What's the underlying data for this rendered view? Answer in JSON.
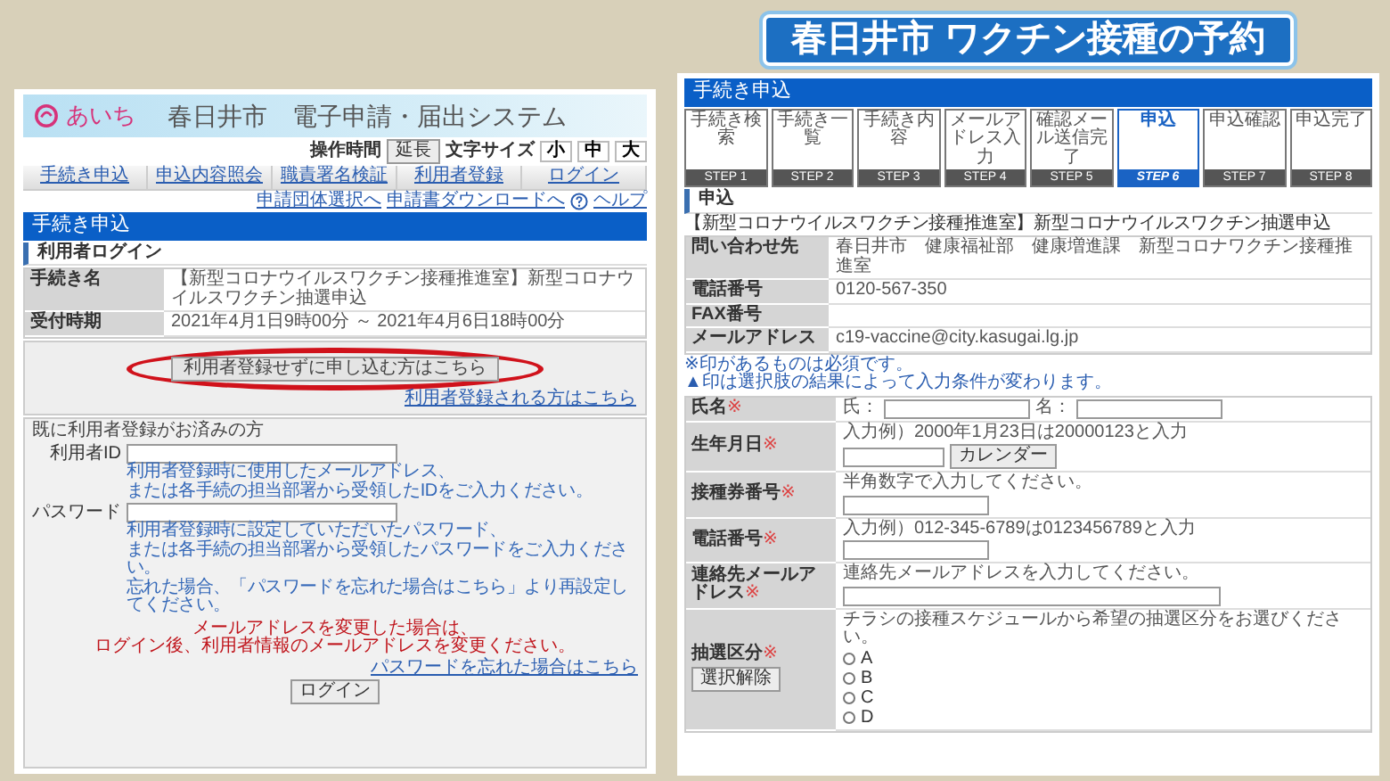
{
  "headline": "春日井市 ワクチン接種の予約",
  "left": {
    "logo": "あいち",
    "system_title": "春日井市　電子申請・届出システム",
    "toolbar": {
      "time_label": "操作時間",
      "extend_button": "延長",
      "font_size_label": "文字サイズ",
      "font_sizes": [
        "小",
        "中",
        "大"
      ]
    },
    "nav": [
      "手続き申込",
      "申込内容照会",
      "職責署名検証",
      "利用者登録",
      "ログイン"
    ],
    "links": [
      "申請団体選択へ",
      "申請書ダウンロードへ",
      "ヘルプ"
    ],
    "section_title": "手続き申込",
    "subsection": "利用者ログイン",
    "info_rows": [
      {
        "label": "手続き名",
        "value": "【新型コロナウイルスワクチン接種推進室】新型コロナウイルスワクチン抽選申込"
      },
      {
        "label": "受付時期",
        "value": "2021年4月1日9時00分 ～ 2021年4月6日18時00分"
      }
    ],
    "guest_button": {
      "label": "利用者登録せずに申し込む方はこちら",
      "circled": true
    },
    "register_link": "利用者登録される方はこちら",
    "login": {
      "title": "既に利用者登録がお済みの方",
      "fields": [
        {
          "label": "利用者ID",
          "hint": [
            "利用者登録時に使用したメールアドレス、",
            "または各手続の担当部署から受領したIDをご入力ください。"
          ]
        },
        {
          "label": "パスワード",
          "hint": [
            "利用者登録時に設定していただいたパスワード、",
            "または各手続の担当部署から受領したパスワードをご入力ください。",
            "忘れた場合、「パスワードを忘れた場合はこちら」より再設定してください。"
          ]
        }
      ],
      "notice": [
        "メールアドレスを変更した場合は、",
        "ログイン後、利用者情報のメールアドレスを変更ください。"
      ],
      "forgot_link": "パスワードを忘れた場合はこちら",
      "button": "ログイン"
    }
  },
  "right": {
    "section_title": "手続き申込",
    "steps": [
      {
        "label": "手続き検索",
        "step": "STEP 1",
        "selected": false
      },
      {
        "label": "手続き一覧",
        "step": "STEP 2",
        "selected": false
      },
      {
        "label": "手続き内容",
        "step": "STEP 3",
        "selected": false
      },
      {
        "label": "メールアドレス入力",
        "step": "STEP 4",
        "selected": false
      },
      {
        "label": "確認メール送信完了",
        "step": "STEP 5",
        "selected": false
      },
      {
        "label": "申込",
        "step": "STEP 6",
        "selected": true
      },
      {
        "label": "申込確認",
        "step": "STEP 7",
        "selected": false
      },
      {
        "label": "申込完了",
        "step": "STEP 8",
        "selected": false
      }
    ],
    "subsection": "申込",
    "form_title": "【新型コロナウイルスワクチン接種推進室】新型コロナウイルスワクチン抽選申込",
    "contact_rows": [
      {
        "label": "問い合わせ先",
        "value": "春日井市　健康福祉部　健康増進課　新型コロナワクチン接種推進室"
      },
      {
        "label": "電話番号",
        "value": "0120-567-350"
      },
      {
        "label": "FAX番号"
      },
      {
        "label": "メールアドレス",
        "value": "c19-vaccine@city.kasugai.lg.jp"
      }
    ],
    "notes": [
      "※印があるものは必須です。",
      "▲印は選択肢の結果によって入力条件が変わります。"
    ],
    "form_rows": [
      {
        "kind": "name",
        "label": "氏名",
        "mark": "※",
        "parts": [
          "氏：",
          "名："
        ]
      },
      {
        "kind": "date",
        "label": "生年月日",
        "mark": "※",
        "hint": "入力例）2000年1月23日は20000123と入力",
        "button": "カレンダー"
      },
      {
        "kind": "text",
        "label": "接種券番号",
        "mark": "※",
        "hint": "半角数字で入力してください。"
      },
      {
        "kind": "text",
        "label": "電話番号",
        "mark": "※",
        "hint": "入力例）012-345-6789は0123456789と入力"
      },
      {
        "kind": "wide",
        "label": "連絡先メールアドレス",
        "mark": "※",
        "hint": "連絡先メールアドレスを入力してください。"
      },
      {
        "kind": "radio",
        "label": "抽選区分",
        "mark": "※",
        "hint": "チラシの接種スケジュールから希望の抽選区分をお選びください。",
        "button": "選択解除",
        "options": [
          {
            "label": "A",
            "selected": false
          },
          {
            "label": "B",
            "selected": false
          },
          {
            "label": "C",
            "selected": false
          },
          {
            "label": "D",
            "selected": false
          }
        ]
      }
    ]
  }
}
